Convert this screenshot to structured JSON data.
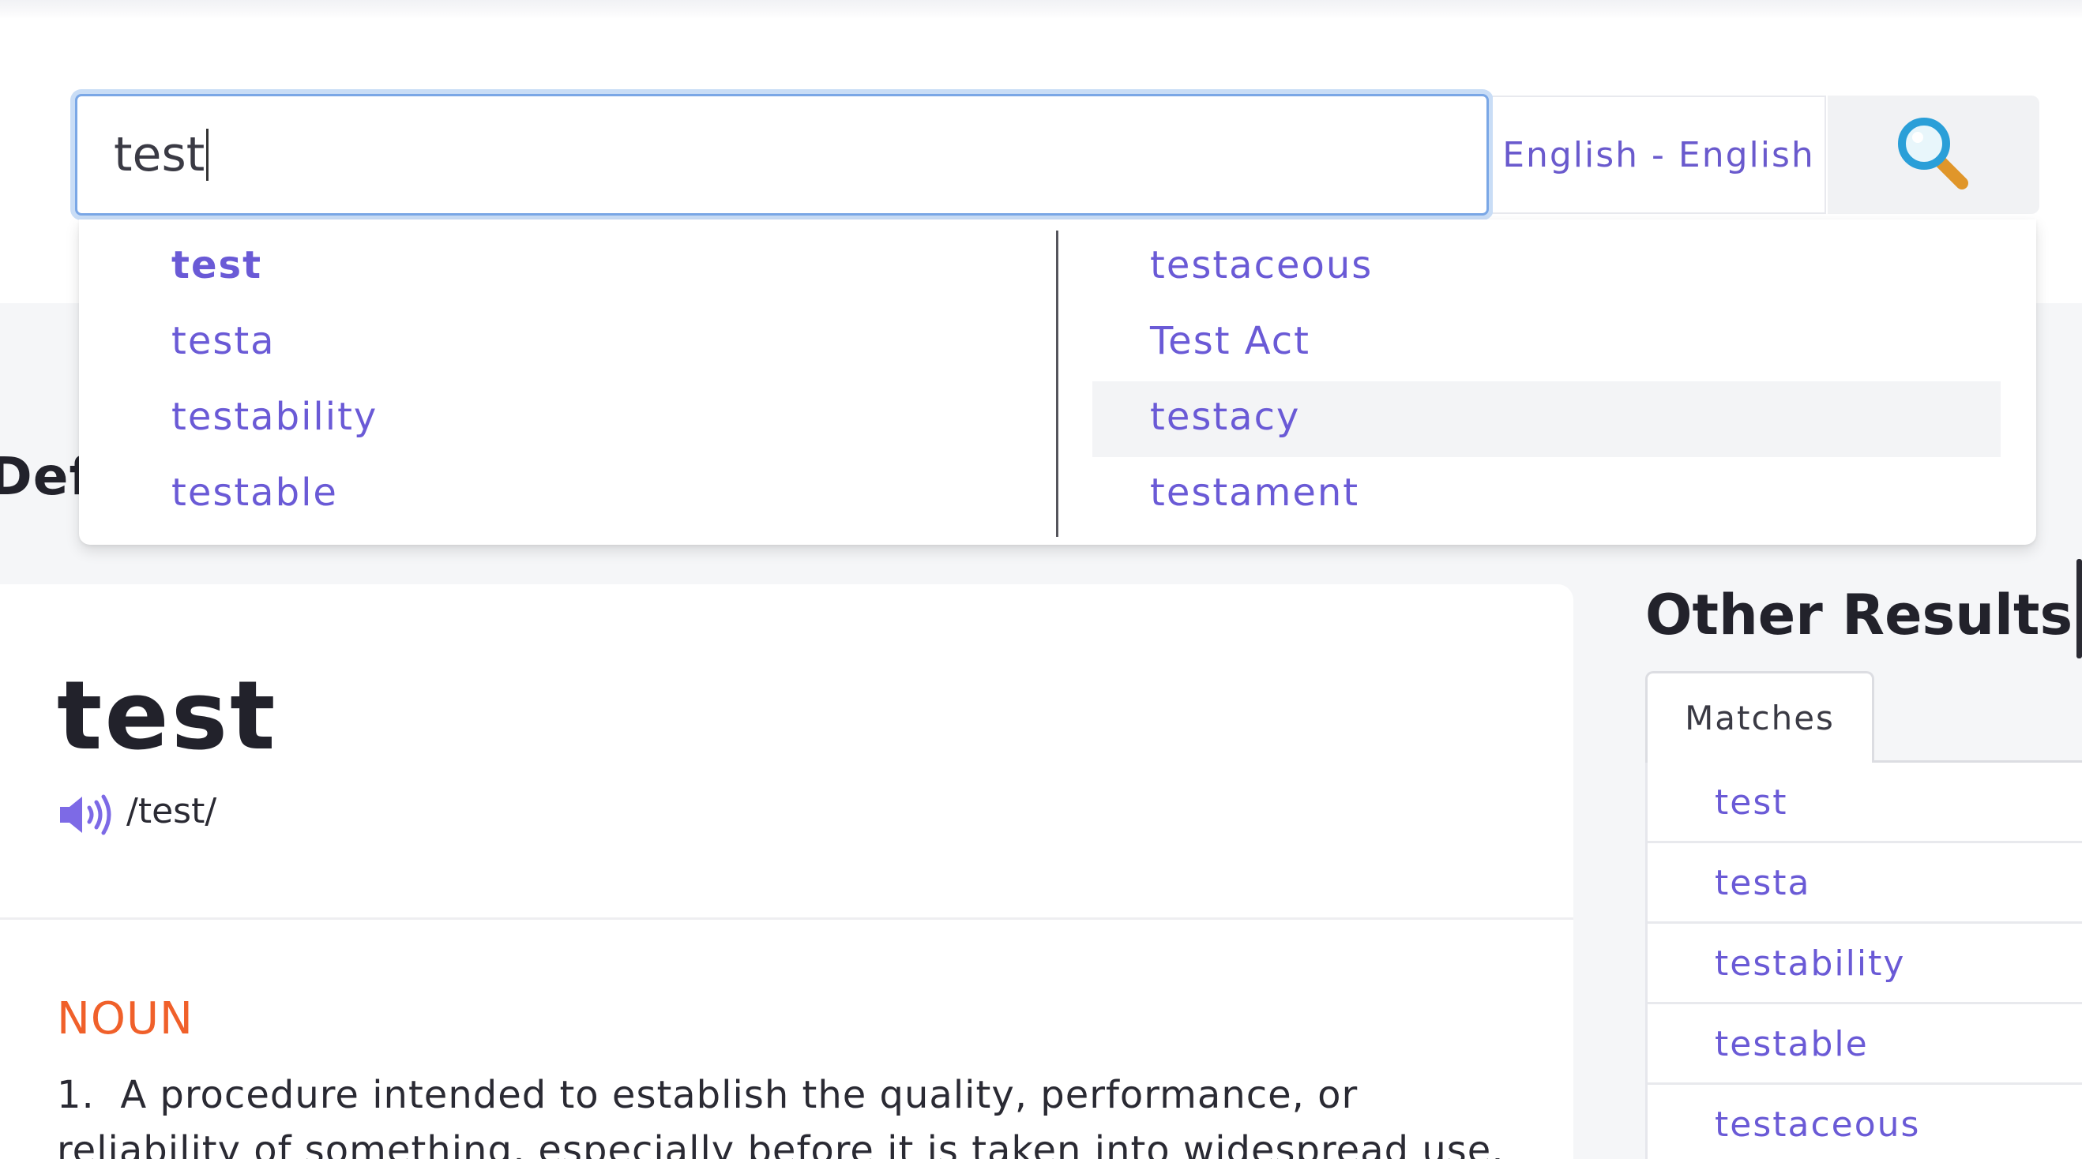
{
  "search": {
    "value": "test",
    "language": "English - English"
  },
  "suggestions": {
    "left": [
      "test",
      "testa",
      "testability",
      "testable"
    ],
    "right": [
      "testaceous",
      "Test Act",
      "testacy",
      "testament"
    ]
  },
  "section_heading": "Def",
  "entry": {
    "word": "test",
    "pronunciation": "/test/",
    "part_of_speech": "NOUN",
    "definition_1_number": "1.",
    "definition_1": "A procedure intended to establish the quality, performance, or reliability of something, especially before it is taken into widespread use."
  },
  "other_results": {
    "title": "Other Results",
    "tab_label": "Matches",
    "items": [
      "test",
      "testa",
      "testability",
      "testable",
      "testaceous"
    ]
  },
  "colors": {
    "accent": "#6a5ad6",
    "part_of_speech": "#f0602a",
    "focus_ring": "#7aa7e6"
  },
  "icons": {
    "search": "magnifier-icon",
    "audio": "speaker-icon"
  }
}
